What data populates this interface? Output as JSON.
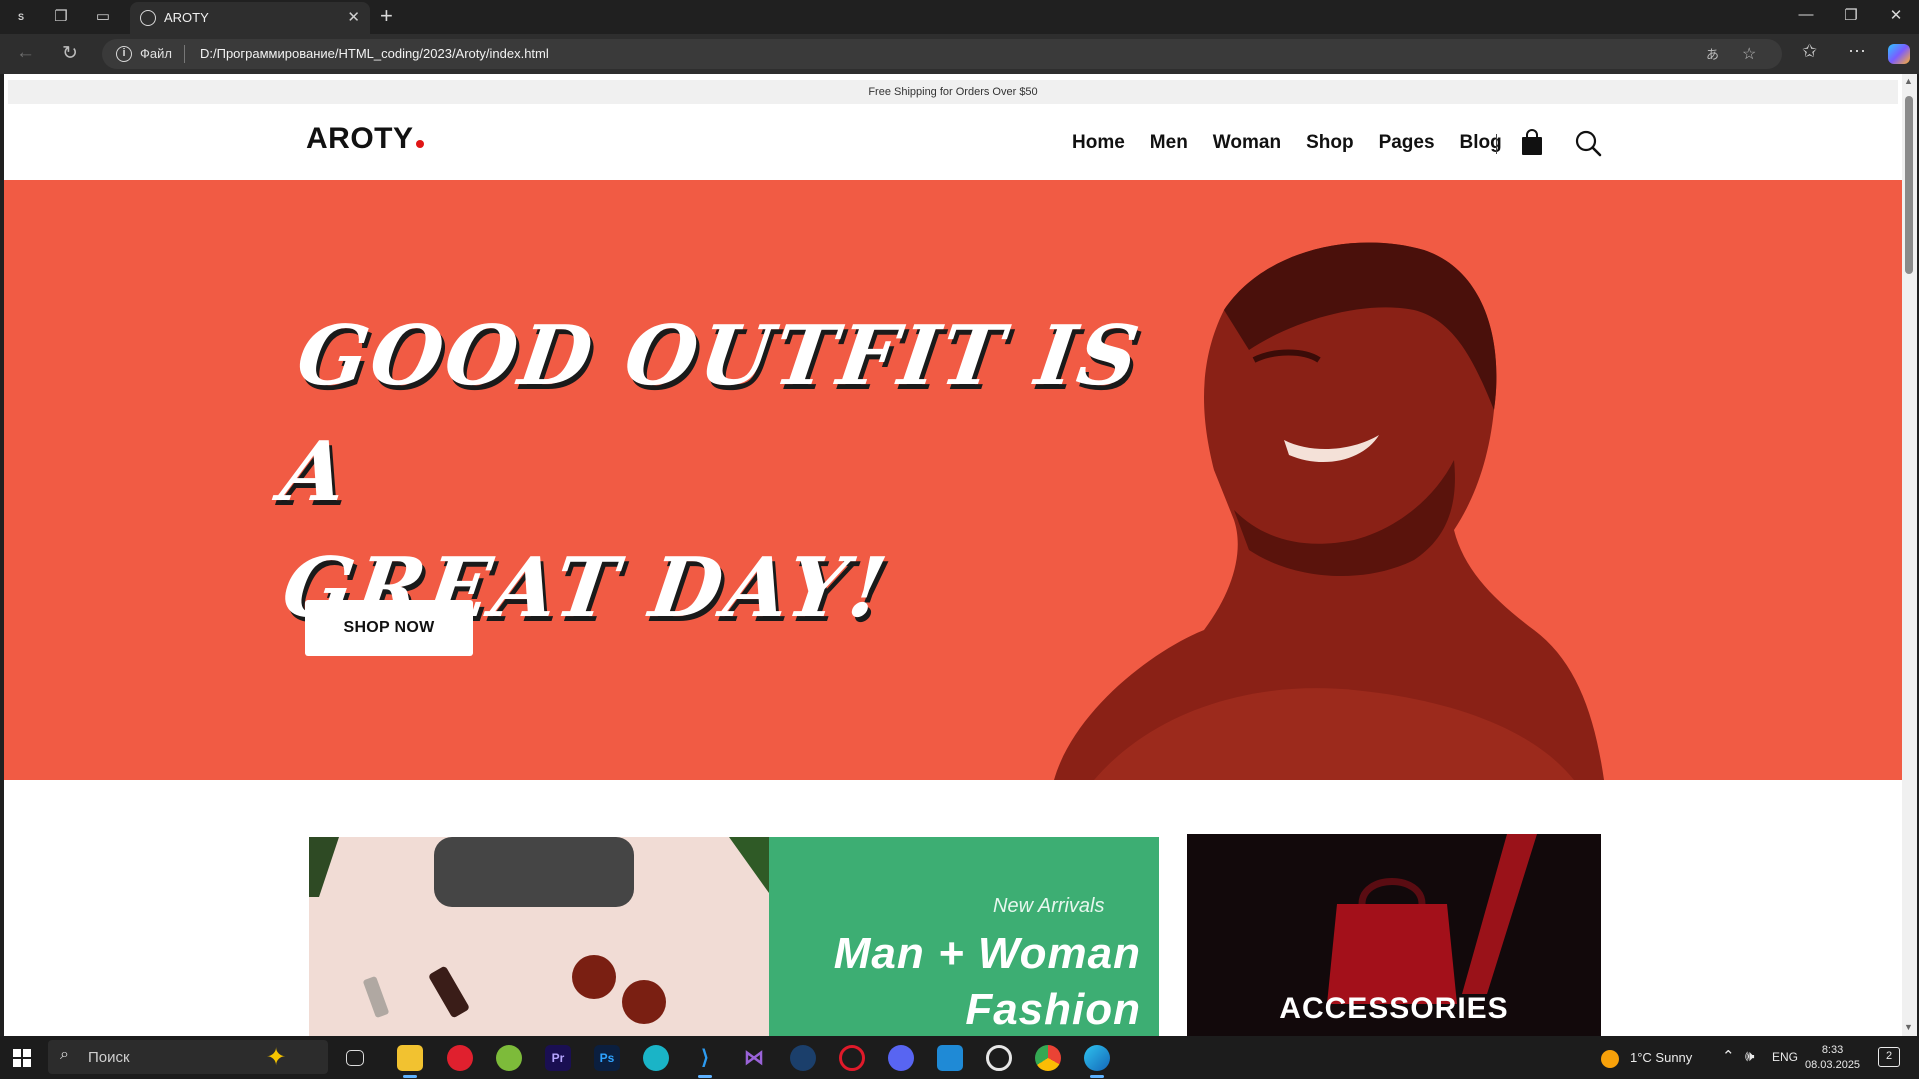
{
  "browser": {
    "tab_title": "AROTY",
    "address_scheme": "Файл",
    "url": "D:/Программирование/HTML_coding/2023/Aroty/index.html"
  },
  "site": {
    "promo": "Free Shipping for Orders Over $50",
    "logo": "AROTY",
    "nav": [
      "Home",
      "Men",
      "Woman",
      "Shop",
      "Pages",
      "Blog"
    ],
    "hero": {
      "title_line1": "GOOD OUTFIT IS A",
      "title_line2": "GREAT DAY!",
      "cta": "SHOP NOW",
      "bg_color": "#f15b44"
    },
    "card_fashion": {
      "subtitle": "New Arrivals",
      "title_line1": "Man + Woman",
      "title_line2": "Fashion"
    },
    "card_accessories": {
      "title": "ACCESSORIES"
    }
  },
  "taskbar": {
    "search_placeholder": "Поиск",
    "weather": "1°C  Sunny",
    "language": "ENG",
    "time": "8:33",
    "date": "08.03.2025",
    "notifications": "2",
    "apps": [
      "task-view",
      "file-explorer",
      "acrobat",
      "app-green",
      "premiere-pro",
      "photoshop",
      "browser-teal",
      "vscode",
      "visual-studio",
      "steam",
      "opera",
      "discord",
      "outlook",
      "overwatch",
      "chrome",
      "edge"
    ]
  }
}
